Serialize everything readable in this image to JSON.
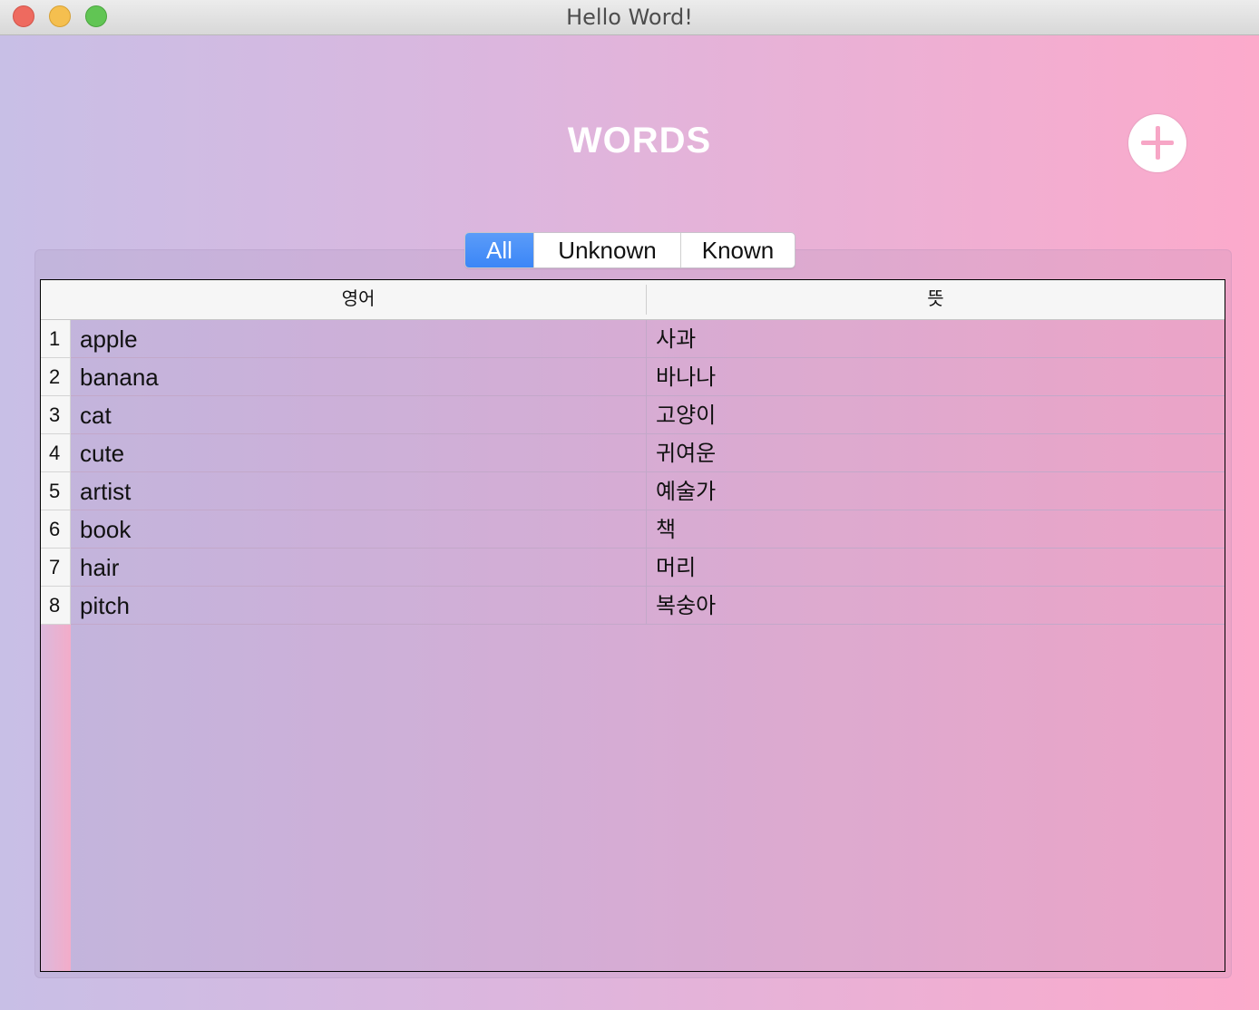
{
  "window": {
    "title": "Hello Word!"
  },
  "colors": {
    "accent": "#3b86f7",
    "add_plus": "#f7a6c6"
  },
  "header": {
    "title": "WORDS",
    "add_icon": "plus-icon"
  },
  "filter": {
    "options": [
      "All",
      "Unknown",
      "Known"
    ],
    "selected": "All"
  },
  "table": {
    "columns": [
      "영어",
      "뜻"
    ],
    "rows": [
      {
        "index": "1",
        "english": "apple",
        "meaning": "사과"
      },
      {
        "index": "2",
        "english": "banana",
        "meaning": "바나나"
      },
      {
        "index": "3",
        "english": "cat",
        "meaning": "고양이"
      },
      {
        "index": "4",
        "english": "cute",
        "meaning": "귀여운"
      },
      {
        "index": "5",
        "english": "artist",
        "meaning": "예술가"
      },
      {
        "index": "6",
        "english": "book",
        "meaning": "책"
      },
      {
        "index": "7",
        "english": "hair",
        "meaning": "머리"
      },
      {
        "index": "8",
        "english": "pitch",
        "meaning": "복숭아"
      }
    ]
  }
}
